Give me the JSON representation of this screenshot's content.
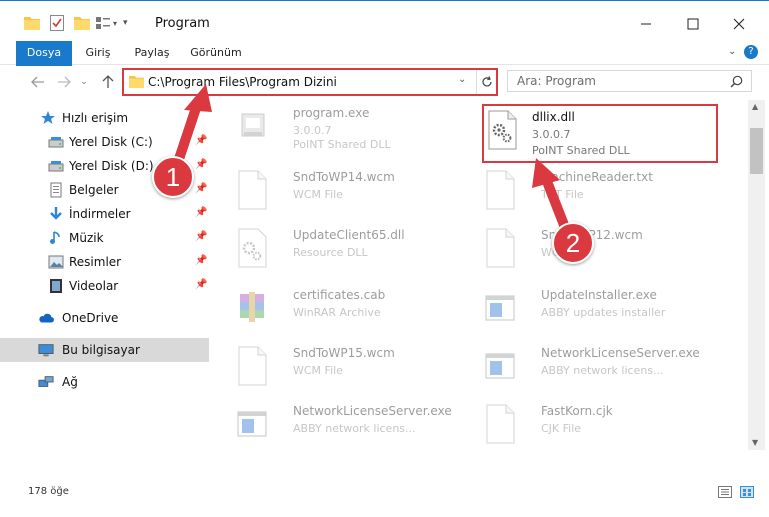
{
  "window": {
    "title": "Program",
    "controls": [
      "minimize-icon",
      "maximize-icon",
      "close-icon"
    ]
  },
  "ribbon": {
    "tabs": [
      {
        "label": "Dosya",
        "active": true
      },
      {
        "label": "Giriş"
      },
      {
        "label": "Paylaş"
      },
      {
        "label": "Görünüm"
      }
    ]
  },
  "address": {
    "path": "C:\\Program Files\\Program Dizini"
  },
  "search": {
    "placeholder": "Ara: Program"
  },
  "sidebar": {
    "items": [
      {
        "label": "Hızlı erişim",
        "icon": "star-icon"
      },
      {
        "label": "Yerel Disk (C:)",
        "icon": "drive-icon",
        "pinned": true
      },
      {
        "label": "Yerel Disk (D:)",
        "icon": "drive-icon",
        "pinned": true
      },
      {
        "label": "Belgeler",
        "icon": "documents-icon",
        "pinned": true
      },
      {
        "label": "İndirmeler",
        "icon": "download-icon",
        "pinned": true
      },
      {
        "label": "Müzik",
        "icon": "music-icon",
        "pinned": true
      },
      {
        "label": "Resimler",
        "icon": "pictures-icon",
        "pinned": true
      },
      {
        "label": "Videolar",
        "icon": "videos-icon",
        "pinned": true
      },
      {
        "label": "OneDrive",
        "icon": "cloud-icon"
      },
      {
        "label": "Bu bilgisayar",
        "icon": "computer-icon",
        "selected": true
      },
      {
        "label": "Ağ",
        "icon": "network-icon"
      }
    ]
  },
  "files": [
    {
      "name": "program.exe",
      "sub1": "3.0.0.7",
      "sub2": "PoINT Shared DLL",
      "icon": "exe-icon"
    },
    {
      "name": "dllix.dll",
      "sub1": "3.0.0.7",
      "sub2": "PoINT Shared DLL",
      "icon": "dll-gear-icon",
      "highlight": true
    },
    {
      "name": "SndToWP14.wcm",
      "sub1": "WCM File",
      "icon": "blank-file-icon"
    },
    {
      "name": "MachineReader.txt",
      "sub1": "TXT File",
      "icon": "blank-file-icon"
    },
    {
      "name": "UpdateClient65.dll",
      "sub1": "Resource DLL",
      "icon": "dll-gear-icon"
    },
    {
      "name": "SndToWP12.wcm",
      "sub1": "WCM File",
      "icon": "blank-file-icon"
    },
    {
      "name": "certificates.cab",
      "sub1": "WinRAR Archive",
      "icon": "archive-icon"
    },
    {
      "name": "UpdateInstaller.exe",
      "sub1": "ABBY updates installer",
      "icon": "window-app-icon"
    },
    {
      "name": "SndToWP15.wcm",
      "sub1": "WCM File",
      "icon": "blank-file-icon"
    },
    {
      "name": "NetworkLicenseServer.exe",
      "sub1": "ABBY network licens...",
      "icon": "window-app-icon"
    },
    {
      "name": "NetworkLicenseServer.exe",
      "sub1": "ABBY network licens...",
      "icon": "window-app-icon"
    },
    {
      "name": "FastKorn.cjk",
      "sub1": "CJK File",
      "icon": "blank-file-icon"
    }
  ],
  "status": {
    "count": "178 öğe"
  },
  "annotations": [
    {
      "label": "1"
    },
    {
      "label": "2"
    }
  ],
  "colors": {
    "accent": "#1979ca",
    "callout": "#d9393f"
  }
}
